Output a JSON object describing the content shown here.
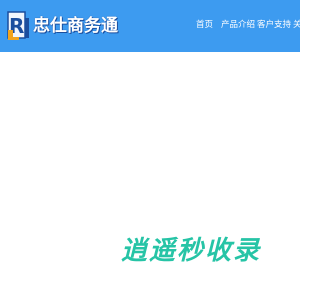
{
  "colors": {
    "header_bg": "#3d9bf0",
    "nav_text": "#ffffff",
    "brand_green": "#26c4a6"
  },
  "header": {
    "logo_text": "忠仕商务通",
    "logo_icon": "rl-logo-icon",
    "nav": [
      {
        "label": "首页"
      },
      {
        "label": "产品介绍"
      },
      {
        "label": "客户支持"
      },
      {
        "label": "关"
      }
    ]
  },
  "footer_brand": {
    "text": "逍遥秒收录"
  }
}
